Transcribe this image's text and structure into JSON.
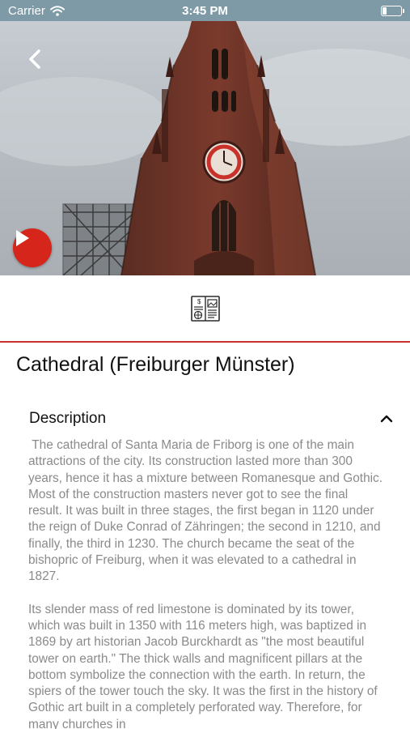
{
  "status_bar": {
    "carrier": "Carrier",
    "time": "3:45 PM",
    "battery_level": 0.25
  },
  "hero": {
    "image_subject": "Freiburg Cathedral tower",
    "back_icon": "chevron-left-icon",
    "play_icon": "play-icon"
  },
  "category": {
    "icon": "brochure-icon"
  },
  "title": "Cathedral (Freiburger Münster)",
  "description": {
    "header": "Description",
    "toggle_icon": "chevron-up-icon",
    "paragraphs": [
      " The cathedral of Santa Maria de Friborg is one of the main attractions of the city. Its construction lasted more than 300 years, hence it has a mixture between Romanesque and Gothic. Most of the construction masters never got to see the final result. It was built in three stages, the first began in 1120 under the reign of Duke Conrad of Zähringen; the second in 1210, and finally, the third in 1230. The church became the seat of the bishopric of Freiburg, when it was elevated to a cathedral in 1827.",
      "Its slender mass of red limestone is dominated by its tower, which was built in 1350 with 116 meters high, was baptized in 1869 by art historian Jacob Burckhardt as \"the most beautiful tower on earth.\" The thick walls and magnificent pillars at the bottom symbolize the connection with the earth. In return, the spiers of the tower touch the sky. It was the first in the history of Gothic art built in a completely perforated way. Therefore, for many churches in"
    ]
  },
  "colors": {
    "accent": "#d6261b",
    "divider": "#c8322b",
    "status_bar": "#7d9aa6",
    "body_text": "#8a8a8a"
  }
}
